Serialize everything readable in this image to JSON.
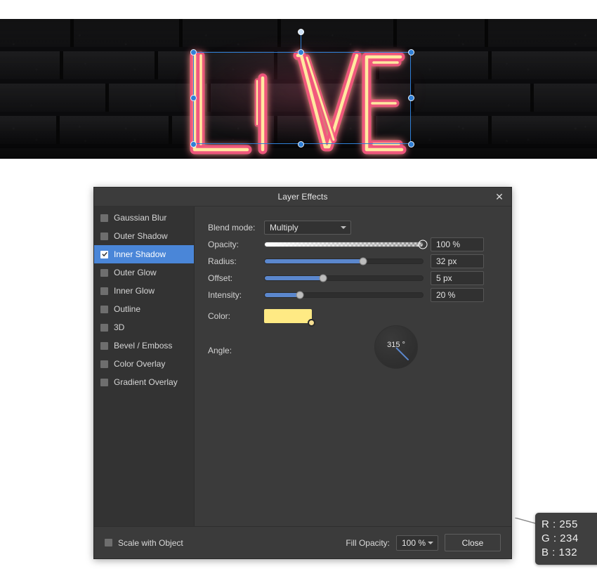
{
  "canvas": {
    "artwork_text": "LIVE",
    "artwork_style": "neon-sign-on-brick-wall",
    "neon_outer_color": "#F2547D",
    "neon_core_color": "#FFE9A0",
    "selection_color": "#2f7fd6"
  },
  "dialog": {
    "title": "Layer Effects",
    "close_icon": "close-icon",
    "effects": [
      {
        "label": "Gaussian Blur",
        "checked": false,
        "selected": false
      },
      {
        "label": "Outer Shadow",
        "checked": false,
        "selected": false
      },
      {
        "label": "Inner Shadow",
        "checked": true,
        "selected": true
      },
      {
        "label": "Outer Glow",
        "checked": false,
        "selected": false
      },
      {
        "label": "Inner Glow",
        "checked": false,
        "selected": false
      },
      {
        "label": "Outline",
        "checked": false,
        "selected": false
      },
      {
        "label": "3D",
        "checked": false,
        "selected": false
      },
      {
        "label": "Bevel / Emboss",
        "checked": false,
        "selected": false
      },
      {
        "label": "Color Overlay",
        "checked": false,
        "selected": false
      },
      {
        "label": "Gradient Overlay",
        "checked": false,
        "selected": false
      }
    ],
    "controls": {
      "blend_mode": {
        "label": "Blend mode:",
        "value": "Multiply"
      },
      "opacity": {
        "label": "Opacity:",
        "value": "100 %",
        "percent": 100
      },
      "radius": {
        "label": "Radius:",
        "value": "32 px",
        "percent": 62
      },
      "offset": {
        "label": "Offset:",
        "value": "5 px",
        "percent": 37
      },
      "intensity": {
        "label": "Intensity:",
        "value": "20 %",
        "percent": 22
      },
      "color": {
        "label": "Color:",
        "hex": "#FFEA84"
      },
      "angle": {
        "label": "Angle:",
        "value": "315 °",
        "degrees": 315
      }
    },
    "color_tooltip": {
      "r": "R : 255",
      "g": "G : 234",
      "b": "B : 132"
    },
    "footer": {
      "scale_with_object": {
        "label": "Scale with Object",
        "checked": false
      },
      "fill_opacity_label": "Fill Opacity:",
      "fill_opacity_value": "100 %",
      "close_label": "Close"
    }
  }
}
